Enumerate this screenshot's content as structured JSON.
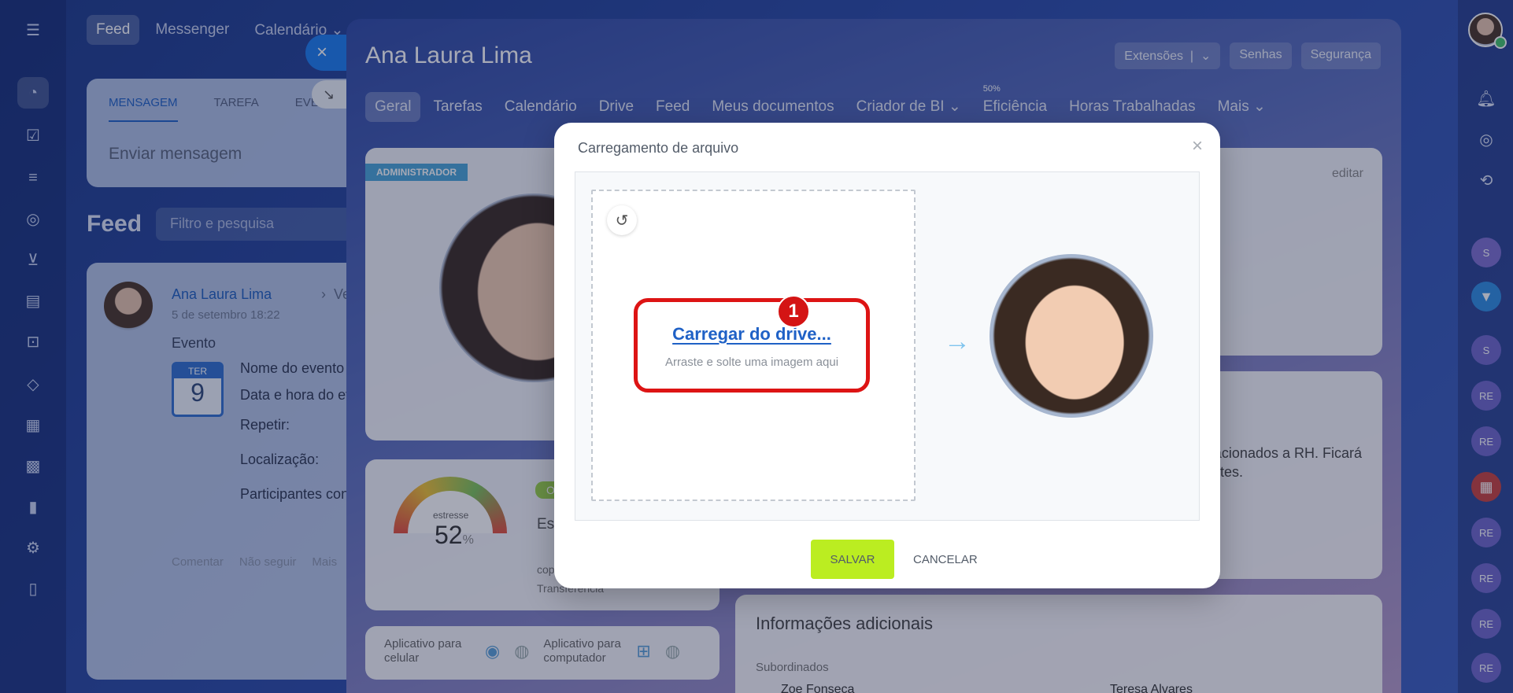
{
  "left_sidebar": {
    "icons": [
      "menu-icon",
      "activity-icon",
      "tasks-icon",
      "funnel-icon",
      "target-icon",
      "cart-icon",
      "contact-card-icon",
      "robot-icon",
      "box-icon",
      "building-icon",
      "calendar-grid-icon",
      "chart-icon",
      "settings-icon",
      "document-icon"
    ]
  },
  "top_nav": {
    "items": [
      {
        "label": "Feed",
        "active": true
      },
      {
        "label": "Messenger",
        "active": false
      },
      {
        "label": "Calendário ⌄",
        "active": false
      }
    ]
  },
  "composer": {
    "tabs": [
      "MENSAGEM",
      "TAREFA",
      "EVE"
    ],
    "placeholder": "Enviar mensagem"
  },
  "feed": {
    "title": "Feed",
    "search_placeholder": "Filtro e pesquisa",
    "post": {
      "author": "Ana Laura Lima",
      "destination": "Vendas",
      "time": "5 de setembro 18:22",
      "type": "Evento",
      "calendar_day_name": "TER",
      "calendar_day": "9",
      "fields": [
        "Nome do evento",
        "Data e hora do ev",
        "Repetir:",
        "Localização:",
        "Participantes con"
      ],
      "actions": [
        "Comentar",
        "Não seguir",
        "Mais"
      ]
    }
  },
  "profile": {
    "name": "Ana Laura Lima",
    "header_buttons": [
      "Extensões",
      "Senhas",
      "Segurança"
    ],
    "tabs": [
      {
        "label": "Geral",
        "active": true
      },
      {
        "label": "Tarefas"
      },
      {
        "label": "Calendário"
      },
      {
        "label": "Drive"
      },
      {
        "label": "Feed"
      },
      {
        "label": "Meus documentos"
      },
      {
        "label": "Criador de BI ⌄"
      },
      {
        "label": "Eficiência",
        "sup": "50%"
      },
      {
        "label": "Horas Trabalhadas"
      },
      {
        "label": "Mais ⌄"
      }
    ],
    "role_badge": "ADMINISTRADOR",
    "stress_label": "estresse",
    "stress_value": "52",
    "stress_unit": "%",
    "stress_status": "O",
    "stress_text": "Est",
    "stress_sub1": "cop",
    "stress_sub2": "Transferência",
    "edit_label": "editar",
    "hr_text_1": "relacionados a RH. Ficará",
    "hr_text_2": "ntes.",
    "additional_info_title": "Informações adicionais",
    "subordinates_label": "Subordinados",
    "subordinates": [
      "Zoe Fonseca",
      "Teresa Alvares"
    ],
    "apps_mobile": "Aplicativo para celular",
    "apps_desktop": "Aplicativo para computador"
  },
  "right_sidebar": {
    "items": [
      "S",
      "bookmark-icon",
      "S",
      "RE",
      "RE",
      "calendar-icon",
      "RE",
      "RE",
      "RE",
      "RE"
    ]
  },
  "modal": {
    "title": "Carregamento de arquivo",
    "close_glyph": "×",
    "undo_glyph": "↺",
    "upload_link": "Carregar do drive...",
    "upload_hint": "Arraste e solte uma imagem aqui",
    "step_number": "1",
    "arrow_glyph": "→",
    "save_label": "SALVAR",
    "cancel_label": "CANCELAR"
  }
}
